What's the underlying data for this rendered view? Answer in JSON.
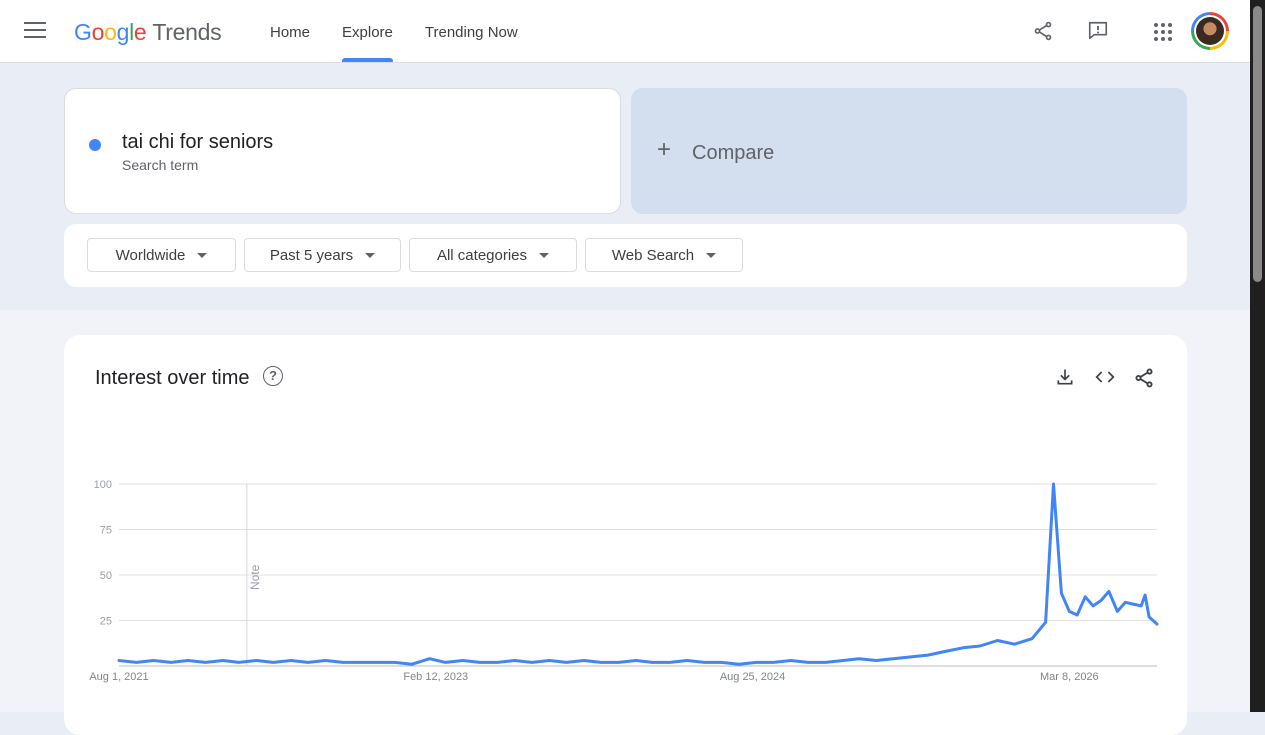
{
  "header": {
    "logo_letters": [
      {
        "ch": "G",
        "color": "#4285f4"
      },
      {
        "ch": "o",
        "color": "#ea4335"
      },
      {
        "ch": "o",
        "color": "#fbbc05"
      },
      {
        "ch": "g",
        "color": "#4285f4"
      },
      {
        "ch": "l",
        "color": "#34a853"
      },
      {
        "ch": "e",
        "color": "#ea4335"
      }
    ],
    "logo_suffix": "Trends",
    "nav": [
      "Home",
      "Explore",
      "Trending Now"
    ],
    "active_tab": "Explore"
  },
  "search": {
    "term": "tai chi for seniors",
    "term_type": "Search term",
    "term_color": "#4285f4",
    "compare_label": "Compare"
  },
  "filters": {
    "region": "Worldwide",
    "period": "Past 5 years",
    "category": "All categories",
    "property": "Web Search"
  },
  "chart_card": {
    "title": "Interest over time",
    "note_label": "Note"
  },
  "chart_data": {
    "type": "line",
    "title": "Interest over time",
    "series": [
      {
        "name": "tai chi for seniors",
        "color": "#4285f4",
        "points": [
          [
            "2021-08-01",
            3
          ],
          [
            "2021-09-01",
            2
          ],
          [
            "2021-10-01",
            3
          ],
          [
            "2021-11-01",
            2
          ],
          [
            "2021-12-01",
            3
          ],
          [
            "2022-01-01",
            2
          ],
          [
            "2022-02-01",
            3
          ],
          [
            "2022-03-01",
            2
          ],
          [
            "2022-04-01",
            3
          ],
          [
            "2022-05-01",
            2
          ],
          [
            "2022-06-01",
            3
          ],
          [
            "2022-07-01",
            2
          ],
          [
            "2022-08-01",
            3
          ],
          [
            "2022-09-01",
            2
          ],
          [
            "2022-10-01",
            2
          ],
          [
            "2022-11-01",
            2
          ],
          [
            "2022-12-01",
            2
          ],
          [
            "2023-01-01",
            1
          ],
          [
            "2023-02-01",
            4
          ],
          [
            "2023-03-01",
            2
          ],
          [
            "2023-04-01",
            3
          ],
          [
            "2023-05-01",
            2
          ],
          [
            "2023-06-01",
            2
          ],
          [
            "2023-07-01",
            3
          ],
          [
            "2023-08-01",
            2
          ],
          [
            "2023-09-01",
            3
          ],
          [
            "2023-10-01",
            2
          ],
          [
            "2023-11-01",
            3
          ],
          [
            "2023-12-01",
            2
          ],
          [
            "2024-01-01",
            2
          ],
          [
            "2024-02-01",
            3
          ],
          [
            "2024-03-01",
            2
          ],
          [
            "2024-04-01",
            2
          ],
          [
            "2024-05-01",
            3
          ],
          [
            "2024-06-01",
            2
          ],
          [
            "2024-07-01",
            2
          ],
          [
            "2024-08-01",
            1
          ],
          [
            "2024-09-01",
            2
          ],
          [
            "2024-10-01",
            2
          ],
          [
            "2024-11-01",
            3
          ],
          [
            "2024-12-01",
            2
          ],
          [
            "2025-01-01",
            2
          ],
          [
            "2025-02-01",
            3
          ],
          [
            "2025-03-01",
            4
          ],
          [
            "2025-04-01",
            3
          ],
          [
            "2025-05-01",
            4
          ],
          [
            "2025-06-01",
            5
          ],
          [
            "2025-07-01",
            6
          ],
          [
            "2025-08-01",
            8
          ],
          [
            "2025-09-01",
            10
          ],
          [
            "2025-10-01",
            11
          ],
          [
            "2025-11-01",
            14
          ],
          [
            "2025-12-01",
            12
          ],
          [
            "2026-01-01",
            15
          ],
          [
            "2026-01-25",
            24
          ],
          [
            "2026-02-08",
            100
          ],
          [
            "2026-02-22",
            40
          ],
          [
            "2026-03-08",
            30
          ],
          [
            "2026-03-22",
            28
          ],
          [
            "2026-04-05",
            38
          ],
          [
            "2026-04-19",
            33
          ],
          [
            "2026-05-03",
            36
          ],
          [
            "2026-05-17",
            41
          ],
          [
            "2026-06-01",
            30
          ],
          [
            "2026-06-15",
            35
          ],
          [
            "2026-06-29",
            34
          ],
          [
            "2026-07-13",
            33
          ],
          [
            "2026-07-20",
            39
          ],
          [
            "2026-07-27",
            27
          ],
          [
            "2026-08-03",
            25
          ],
          [
            "2026-08-10",
            23
          ]
        ]
      }
    ],
    "x_ticks": [
      {
        "date": "2021-08-01",
        "label": "Aug 1, 2021"
      },
      {
        "date": "2023-02-12",
        "label": "Feb 12, 2023"
      },
      {
        "date": "2024-08-25",
        "label": "Aug 25, 2024"
      },
      {
        "date": "2026-03-08",
        "label": "Mar 8, 2026"
      }
    ],
    "y_ticks": [
      25,
      50,
      75,
      100
    ],
    "ylim": [
      0,
      100
    ],
    "xlim": [
      "2021-08-01",
      "2026-08-10"
    ],
    "note_date": "2022-03-15",
    "grid": true
  }
}
